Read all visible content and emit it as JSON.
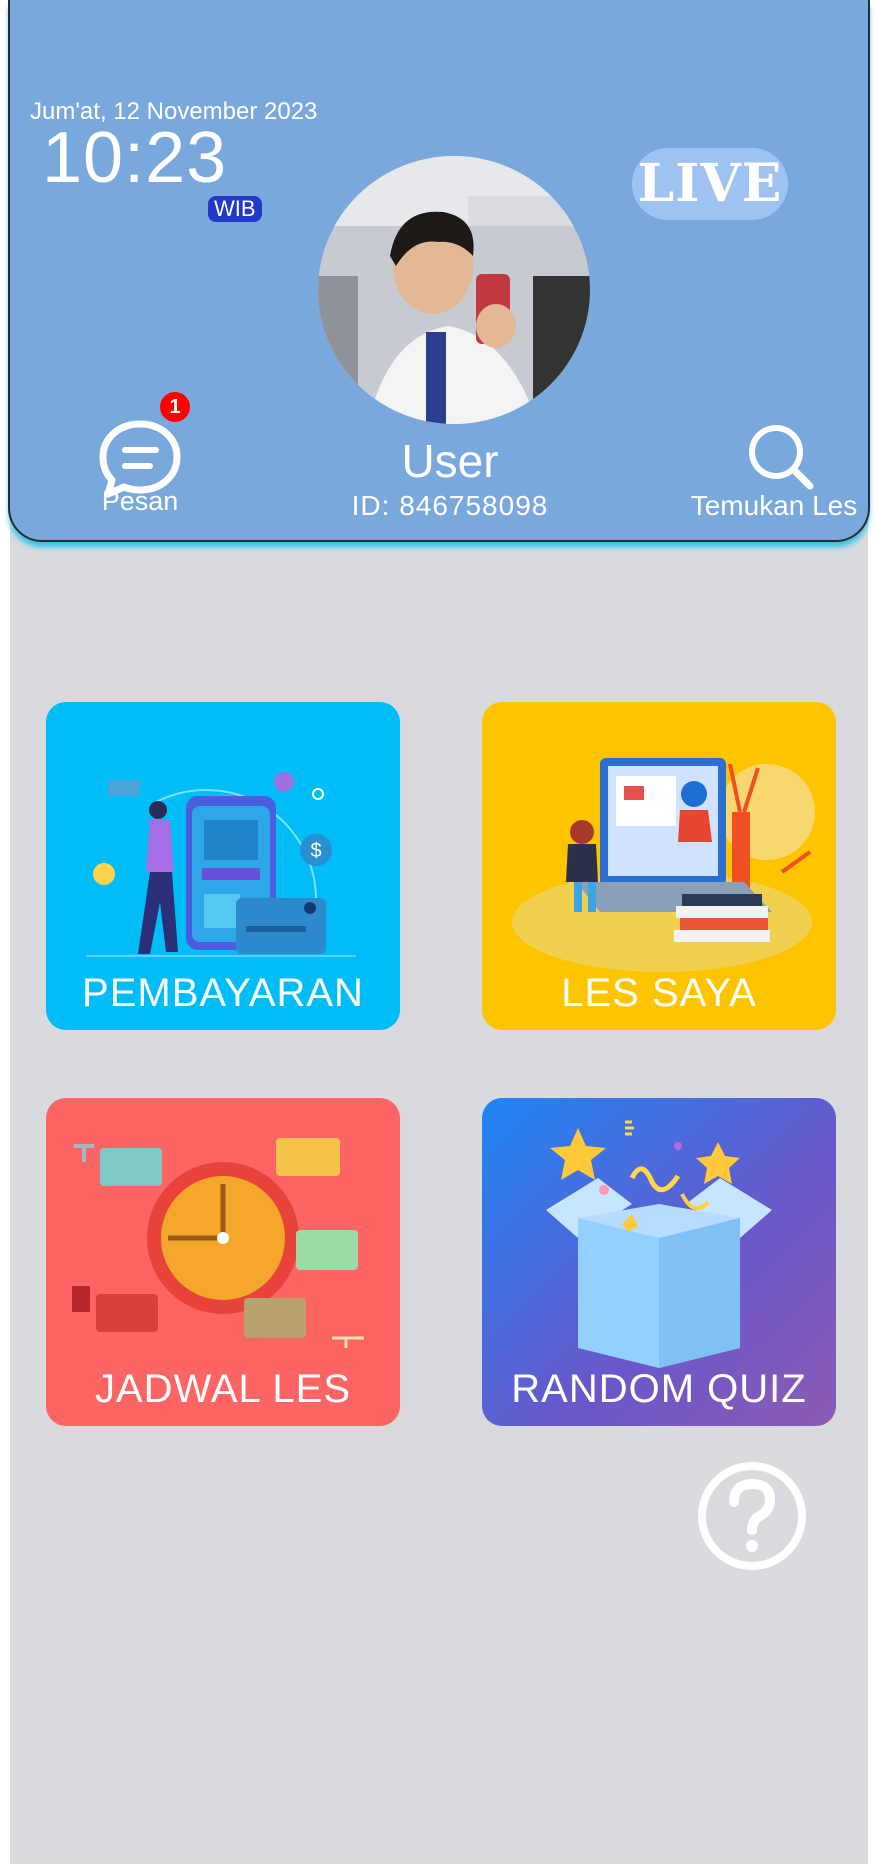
{
  "header": {
    "date": "Jum'at, 12 November 2023",
    "time": "10:23",
    "timezone": "WIB",
    "live_label": "LIVE",
    "user_name": "User",
    "user_id": "ID: 846758098"
  },
  "actions": {
    "messages_label": "Pesan",
    "messages_badge": "1",
    "find_label": "Temukan Les"
  },
  "menu": [
    {
      "label": "PEMBAYARAN",
      "color": "#00bdf8"
    },
    {
      "label": "LES SAYA",
      "color": "#ffc400"
    },
    {
      "label": "JADWAL LES",
      "color": "#fd6464"
    },
    {
      "label": "RANDOM QUIZ",
      "color": "#5a5fd3"
    }
  ],
  "icons": [
    "chat-icon",
    "search-icon",
    "help-icon"
  ]
}
